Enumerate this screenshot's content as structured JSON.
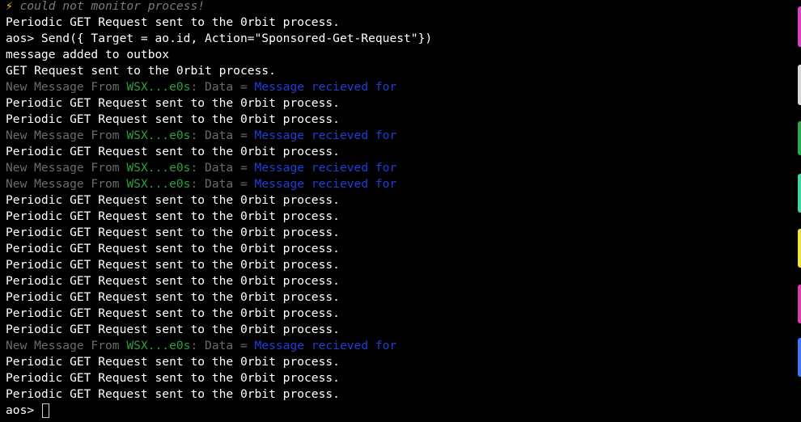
{
  "terminal": {
    "warning": {
      "icon": "lightning-icon",
      "text": " could not monitor process!"
    },
    "prompt": "aos>",
    "lines": [
      {
        "type": "plain",
        "text": "Periodic GET Request sent to the 0rbit process."
      },
      {
        "type": "plain",
        "text": "aos> Send({ Target = ao.id, Action=\"Sponsored-Get-Request\"})"
      },
      {
        "type": "plain",
        "text": "message added to outbox"
      },
      {
        "type": "plain",
        "text": "GET Request sent to the 0rbit process."
      },
      {
        "type": "message",
        "prefix": "New Message From ",
        "sender": "WSX...e0s",
        "mid": ": Data = ",
        "data": "Message recieved for"
      },
      {
        "type": "plain",
        "text": "Periodic GET Request sent to the 0rbit process."
      },
      {
        "type": "plain",
        "text": "Periodic GET Request sent to the 0rbit process."
      },
      {
        "type": "message",
        "prefix": "New Message From ",
        "sender": "WSX...e0s",
        "mid": ": Data = ",
        "data": "Message recieved for"
      },
      {
        "type": "plain",
        "text": "Periodic GET Request sent to the 0rbit process."
      },
      {
        "type": "message",
        "prefix": "New Message From ",
        "sender": "WSX...e0s",
        "mid": ": Data = ",
        "data": "Message recieved for"
      },
      {
        "type": "message",
        "prefix": "New Message From ",
        "sender": "WSX...e0s",
        "mid": ": Data = ",
        "data": "Message recieved for"
      },
      {
        "type": "plain",
        "text": "Periodic GET Request sent to the 0rbit process."
      },
      {
        "type": "plain",
        "text": "Periodic GET Request sent to the 0rbit process."
      },
      {
        "type": "plain",
        "text": "Periodic GET Request sent to the 0rbit process."
      },
      {
        "type": "plain",
        "text": "Periodic GET Request sent to the 0rbit process."
      },
      {
        "type": "plain",
        "text": "Periodic GET Request sent to the 0rbit process."
      },
      {
        "type": "plain",
        "text": "Periodic GET Request sent to the 0rbit process."
      },
      {
        "type": "plain",
        "text": "Periodic GET Request sent to the 0rbit process."
      },
      {
        "type": "plain",
        "text": "Periodic GET Request sent to the 0rbit process."
      },
      {
        "type": "plain",
        "text": "Periodic GET Request sent to the 0rbit process."
      },
      {
        "type": "message",
        "prefix": "New Message From ",
        "sender": "WSX...e0s",
        "mid": ": Data = ",
        "data": "Message recieved for"
      },
      {
        "type": "plain",
        "text": "Periodic GET Request sent to the 0rbit process."
      },
      {
        "type": "plain",
        "text": "Periodic GET Request sent to the 0rbit process."
      },
      {
        "type": "plain",
        "text": "Periodic GET Request sent to the 0rbit process."
      }
    ]
  },
  "colors": {
    "background": "#000000",
    "text": "#ffffff",
    "dim": "#6b6b6b",
    "sender": "#2e9e3e",
    "data": "#1f3fd6",
    "edge_tabs": [
      "#e040c8",
      "#d8d8d8",
      "#2ea84a",
      "#3cd6a0",
      "#f2e23c",
      "#d040b0",
      "#3a7cf0"
    ]
  }
}
